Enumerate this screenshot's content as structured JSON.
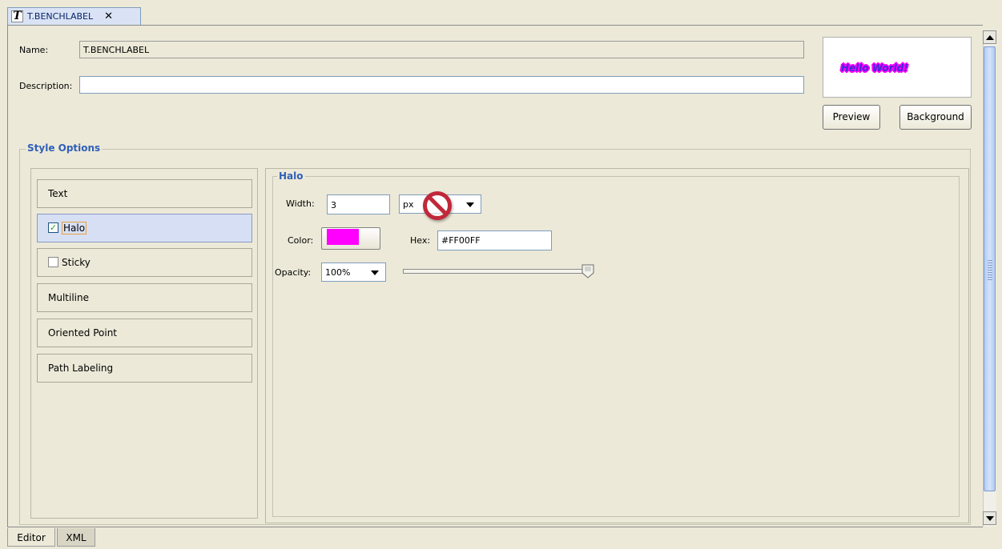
{
  "top_tab": {
    "icon_glyph": "T",
    "label": "T.BENCHLABEL",
    "close_glyph": "✕"
  },
  "form": {
    "name_label": "Name:",
    "name_value": "T.BENCHLABEL",
    "description_label": "Description:",
    "description_value": ""
  },
  "preview": {
    "text": "Hello World!",
    "preview_button": "Preview",
    "background_button": "Background"
  },
  "style_options": {
    "title": "Style Options",
    "items": [
      {
        "label": "Text",
        "checkbox": null,
        "selected": false
      },
      {
        "label": "Halo",
        "checkbox": true,
        "selected": true
      },
      {
        "label": "Sticky",
        "checkbox": false,
        "selected": false
      },
      {
        "label": "Multiline",
        "checkbox": null,
        "selected": false
      },
      {
        "label": "Oriented Point",
        "checkbox": null,
        "selected": false
      },
      {
        "label": "Path Labeling",
        "checkbox": null,
        "selected": false
      }
    ]
  },
  "halo": {
    "title": "Halo",
    "width_label": "Width:",
    "width_value": "3",
    "unit_value": "px",
    "color_label": "Color:",
    "color_value": "#ff00ff",
    "hex_label": "Hex:",
    "hex_value": "#FF00FF",
    "opacity_label": "Opacity:",
    "opacity_value": "100%",
    "opacity_fraction": 1.0
  },
  "bottom_tabs": [
    {
      "label": "Editor",
      "active": true
    },
    {
      "label": "XML",
      "active": false
    }
  ],
  "colors": {
    "accent_title": "#2f5fb8",
    "selected_item": "#d6dff4",
    "halo_color": "#ff00ff"
  },
  "icons": [
    "t-style-icon",
    "close-icon",
    "checkbox-icon",
    "no-symbol-icon",
    "dropdown-arrow-icon",
    "slider-thumb-icon",
    "scroll-up-icon",
    "scroll-down-icon"
  ]
}
